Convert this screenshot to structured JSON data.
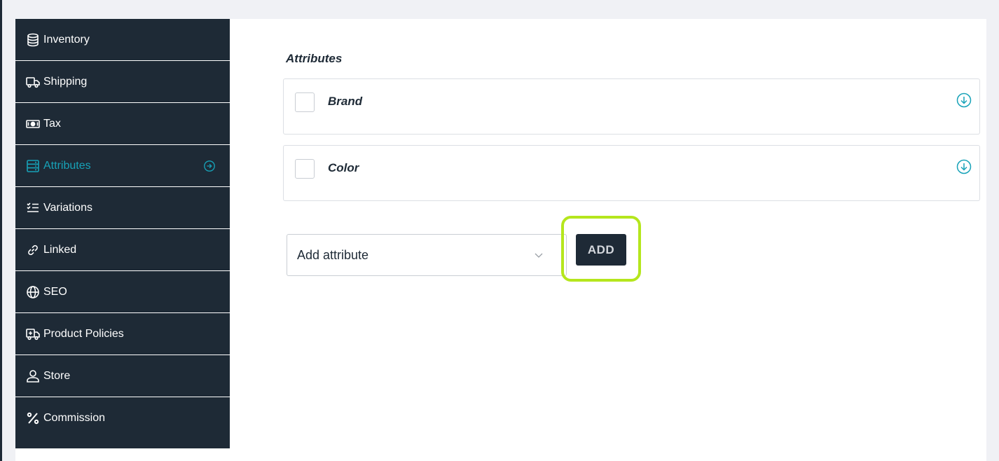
{
  "sidebar": {
    "items": [
      {
        "label": "Inventory",
        "icon": "database-icon"
      },
      {
        "label": "Shipping",
        "icon": "truck-icon"
      },
      {
        "label": "Tax",
        "icon": "money-icon"
      },
      {
        "label": "Attributes",
        "icon": "server-icon",
        "active": true
      },
      {
        "label": "Variations",
        "icon": "list-check-icon"
      },
      {
        "label": "Linked",
        "icon": "link-icon"
      },
      {
        "label": "SEO",
        "icon": "globe-icon"
      },
      {
        "label": "Product Policies",
        "icon": "policy-truck-icon"
      },
      {
        "label": "Store",
        "icon": "user-icon"
      },
      {
        "label": "Commission",
        "icon": "percent-icon"
      }
    ],
    "active_color": "#17a2b8",
    "background": "#1e2a36"
  },
  "main": {
    "section_title": "Attributes",
    "attributes": [
      {
        "label": "Brand"
      },
      {
        "label": "Color"
      }
    ],
    "select": {
      "value": "Add attribute"
    },
    "add_button_label": "ADD",
    "highlight_color": "#b5e61d"
  }
}
